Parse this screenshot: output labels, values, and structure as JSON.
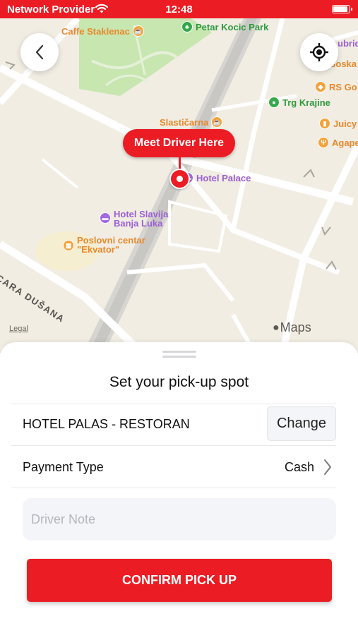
{
  "status_bar": {
    "carrier": "Network Provider",
    "time": "12:48",
    "battery_level": 0.9,
    "wifi_icon": "wifi-icon",
    "battery_icon": "battery-icon"
  },
  "map": {
    "pois": [
      {
        "name": "Caffe Staklenac",
        "kind": "orange",
        "icon": "cafe-icon"
      },
      {
        "name": "Petar Kocic Park",
        "kind": "green",
        "icon": "tree-icon"
      },
      {
        "name": "ubrique",
        "kind": "purple",
        "icon": "shop-icon"
      },
      {
        "name": "Boska",
        "kind": "orange",
        "icon": "shop-icon"
      },
      {
        "name": "RS Go",
        "kind": "orange",
        "icon": "shop-icon"
      },
      {
        "name": "Trg Krajine",
        "kind": "green",
        "icon": "park-icon"
      },
      {
        "name": "Juicy",
        "kind": "orange",
        "icon": "cup-icon"
      },
      {
        "name": "Agape",
        "kind": "orange",
        "icon": "food-icon"
      },
      {
        "name": "Slastičarna",
        "kind": "orange",
        "icon": "cafe-icon"
      },
      {
        "name": "Hotel Palace",
        "kind": "purple",
        "icon": "bed-icon"
      },
      {
        "name": "Hotel Slavija Banja Luka",
        "kind": "purple",
        "icon": "bed-icon"
      },
      {
        "name": "Poslovni centar \"Ekvator\"",
        "kind": "orange",
        "icon": "building-icon"
      }
    ],
    "street_label": "CARA DUŠANA",
    "pin_callout": "Meet Driver Here",
    "legal": "Legal",
    "maps_brand": "Maps",
    "back_icon": "chevron-left-icon",
    "locate_icon": "crosshair-icon"
  },
  "sheet": {
    "title": "Set your pick-up spot",
    "place_name": "HOTEL PALAS - RESTORAN",
    "change_label": "Change",
    "payment_label": "Payment Type",
    "payment_value": "Cash",
    "note_placeholder": "Driver Note",
    "note_value": "",
    "confirm_label": "CONFIRM PICK UP"
  },
  "colors": {
    "accent": "#ec1c24",
    "map_land": "#f1ede3",
    "park": "#c8e6b0",
    "poi_orange": "#e8892c",
    "poi_green": "#2e9a3e",
    "poi_purple": "#9c5fd6"
  }
}
